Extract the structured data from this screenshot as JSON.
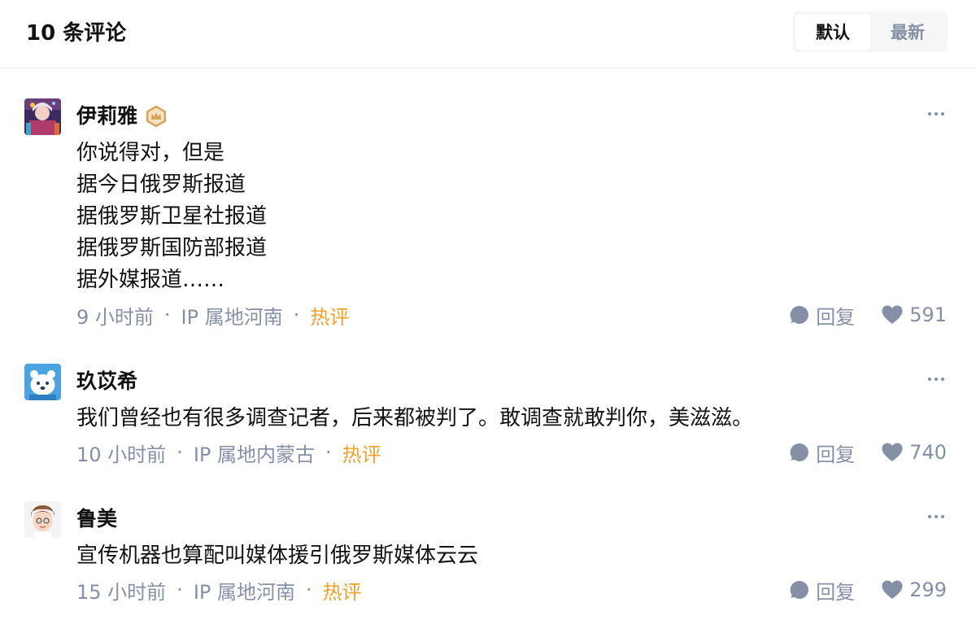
{
  "header": {
    "title": "10 条评论",
    "sort_options": [
      {
        "label": "默认",
        "active": true
      },
      {
        "label": "最新",
        "active": false
      }
    ]
  },
  "colors": {
    "text": "#121212",
    "secondary": "#8590a6",
    "hot": "#f0a12a",
    "badge": "#d9a55a"
  },
  "comments": [
    {
      "author": "伊莉雅",
      "avatar_icon": "anime-character-avatar",
      "badge_icon": "crown-badge-icon",
      "lines": [
        "你说得对，但是",
        "据今日俄罗斯报道",
        "据俄罗斯卫星社报道",
        "据俄罗斯国防部报道",
        "据外媒报道……"
      ],
      "time": "9 小时前",
      "ip": "IP 属地河南",
      "hot": "热评",
      "reply_label": "回复",
      "likes": "591",
      "separator": "·"
    },
    {
      "author": "玖苡希",
      "avatar_icon": "blue-cartoon-bear-avatar",
      "lines": [
        "我们曾经也有很多调查记者，后来都被判了。敢调查就敢判你，美滋滋。"
      ],
      "time": "10 小时前",
      "ip": "IP 属地内蒙古",
      "hot": "热评",
      "reply_label": "回复",
      "likes": "740",
      "separator": "·"
    },
    {
      "author": "鲁美",
      "avatar_icon": "cartoon-boy-avatar",
      "lines": [
        "宣传机器也算配叫媒体援引俄罗斯媒体云云"
      ],
      "time": "15 小时前",
      "ip": "IP 属地河南",
      "hot": "热评",
      "reply_label": "回复",
      "likes": "299",
      "separator": "·"
    }
  ]
}
